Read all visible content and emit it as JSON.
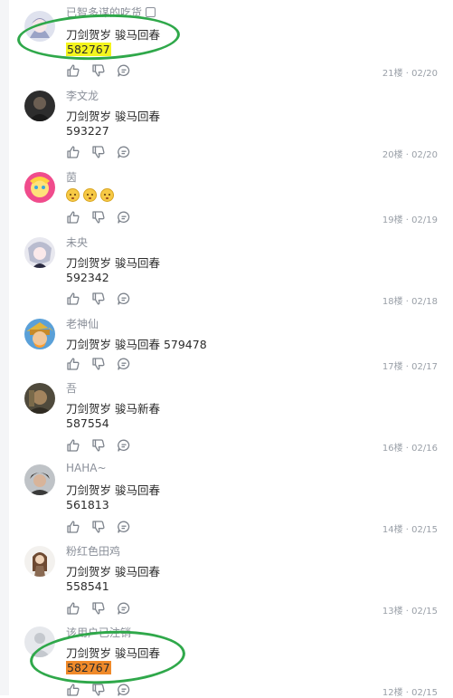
{
  "comments": [
    {
      "user": "已智多谋的吃货",
      "lines": [
        "刀剑贺岁 骏马回春"
      ],
      "code": "582767",
      "code_highlight": "#f5f51e",
      "floor": "21楼",
      "date": "02/20",
      "meta": "21楼 · 02/20"
    },
    {
      "user": "李文龙",
      "lines": [
        "刀剑贺岁 骏马回春",
        "593227"
      ],
      "floor": "20楼",
      "date": "02/20",
      "meta": "20楼 · 02/20"
    },
    {
      "user": "茵",
      "lines": [],
      "emoji_count": 3,
      "floor": "19楼",
      "date": "02/19",
      "meta": "19楼 · 02/19"
    },
    {
      "user": "未央",
      "lines": [
        "刀剑贺岁 骏马回春",
        "592342"
      ],
      "floor": "18楼",
      "date": "02/18",
      "meta": "18楼 · 02/18"
    },
    {
      "user": "老神仙",
      "lines": [
        "刀剑贺岁 骏马回春 579478"
      ],
      "floor": "17楼",
      "date": "02/17",
      "meta": "17楼 · 02/17"
    },
    {
      "user": "吾",
      "lines": [
        "刀剑贺岁 骏马新春",
        "587554"
      ],
      "floor": "16楼",
      "date": "02/16",
      "meta": "16楼 · 02/16"
    },
    {
      "user": "HAHA~",
      "lines": [
        "刀剑贺岁 骏马回春",
        "561813"
      ],
      "floor": "14楼",
      "date": "02/15",
      "meta": "14楼 · 02/15"
    },
    {
      "user": "粉红色田鸡",
      "lines": [
        "刀剑贺岁 骏马回春",
        "558541"
      ],
      "floor": "13楼",
      "date": "02/15",
      "meta": "13楼 · 02/15"
    },
    {
      "user": "该用户已注销",
      "lines": [
        "刀剑贺岁 骏马回春"
      ],
      "code": "582767",
      "code_highlight": "#f08a2a",
      "floor": "12楼",
      "date": "02/15",
      "meta": "12楼 · 02/15"
    }
  ],
  "icons": {
    "like": "thumbs-up-icon",
    "dislike": "thumbs-down-icon",
    "reply": "reply-bubble-icon"
  },
  "annotation_color": "#2fa84a"
}
